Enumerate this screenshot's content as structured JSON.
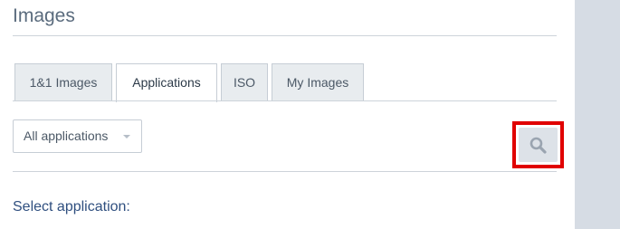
{
  "page": {
    "title": "Images"
  },
  "tabs": [
    {
      "label": "1&1 Images",
      "active": false
    },
    {
      "label": "Applications",
      "active": true
    },
    {
      "label": "ISO",
      "active": false
    },
    {
      "label": "My Images",
      "active": false
    }
  ],
  "filter": {
    "selected": "All applications"
  },
  "section": {
    "label": "Select application:"
  },
  "colors": {
    "accent": "#2f4f7f",
    "highlight": "#e00000",
    "top_border": "#3b5277"
  },
  "icons": {
    "search": "magnifier-icon",
    "caret": "chevron-down-icon"
  }
}
